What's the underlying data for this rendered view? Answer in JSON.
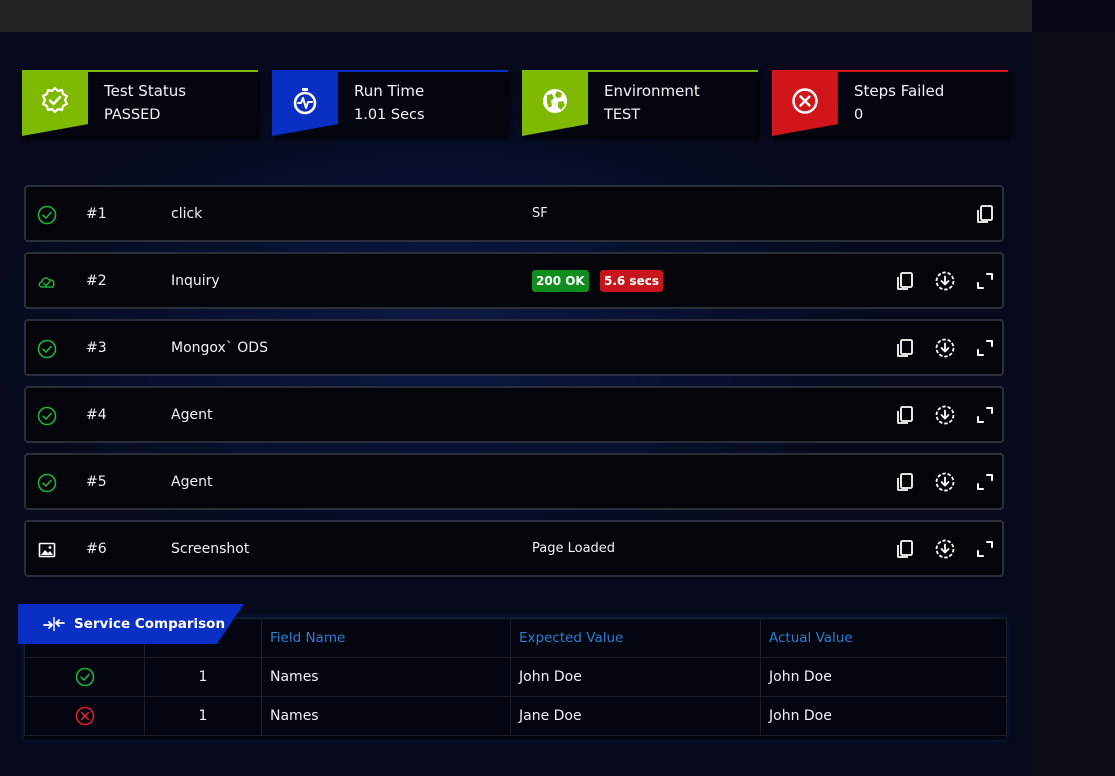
{
  "cards": [
    {
      "title": "Test Status",
      "value": "PASSED",
      "color": "#7fba00",
      "icon": "badge-check-icon"
    },
    {
      "title": "Run Time",
      "value": "1.01 Secs",
      "color": "#0a2fc4",
      "icon": "stopwatch-icon"
    },
    {
      "title": "Environment",
      "value": "TEST",
      "color": "#7fba00",
      "icon": "globe-icon"
    },
    {
      "title": "Steps Failed",
      "value": "0",
      "color": "#d0161b",
      "icon": "x-circle-icon"
    }
  ],
  "steps": [
    {
      "num": "#1",
      "name": "click",
      "info": "SF",
      "status_icon": "check-circle-icon"
    },
    {
      "num": "#2",
      "name": "Inquiry",
      "status_icon": "cloud-check-icon",
      "badges": {
        "status": "200 OK",
        "time": "5.6 secs"
      }
    },
    {
      "num": "#3",
      "name": "Mongox` ODS",
      "status_icon": "check-circle-icon"
    },
    {
      "num": "#4",
      "name": "Agent",
      "status_icon": "check-circle-icon"
    },
    {
      "num": "#5",
      "name": "Agent",
      "status_icon": "check-circle-icon"
    },
    {
      "num": "#6",
      "name": "Screenshot",
      "info": "Page Loaded",
      "status_icon": "image-icon"
    }
  ],
  "comparison": {
    "title": "Service Comparison",
    "headers": [
      "",
      "",
      "Field Name",
      "Expected Value",
      "Actual Value"
    ],
    "rows": [
      {
        "status": "pass",
        "index": "1",
        "field": "Names",
        "expected": "John Doe",
        "actual": "John Doe"
      },
      {
        "status": "fail",
        "index": "1",
        "field": "Names",
        "expected": "Jane Doe",
        "actual": "John Doe"
      }
    ]
  },
  "colors": {
    "pass": "#1db43a",
    "fail": "#e0202a",
    "badge_ok": "#0f8d1e",
    "badge_time": "#c8151b",
    "header_text": "#2a7fd0"
  }
}
